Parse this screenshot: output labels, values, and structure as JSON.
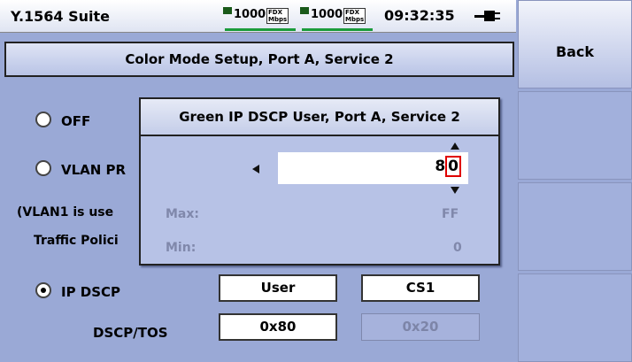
{
  "header": {
    "title": "Y.1564 Suite",
    "link1": {
      "speed": "1000",
      "duplex": "FDX",
      "unit": "Mbps",
      "color": "#1a9b3a"
    },
    "link2": {
      "speed": "1000",
      "duplex": "FDX",
      "unit": "Mbps",
      "color": "#1a9b3a"
    },
    "time": "09:32:35",
    "power_icon": "ac-plug-icon"
  },
  "page": {
    "title": "Color Mode Setup, Port A, Service 2"
  },
  "options": {
    "off": {
      "label": "OFF",
      "selected": false
    },
    "vlan": {
      "label": "VLAN PR",
      "selected": false
    },
    "vlan_note": "(VLAN1 is use",
    "traffic_policing": "Traffic Polici",
    "ip_dscp": {
      "label": "IP DSCP",
      "selected": true
    }
  },
  "fields": {
    "dscp_mode": "User",
    "dscp_class": "CS1",
    "dscp_tos_label": "DSCP/TOS",
    "dscp_tos_value": "0x80",
    "dscp_tos_other": "0x20"
  },
  "dialog": {
    "title": "Green IP DSCP User, Port A, Service 2",
    "value_prefix": "8",
    "value_cursor": "0",
    "max_label": "Max:",
    "max_value": "FF",
    "min_label": "Min:",
    "min_value": "0"
  },
  "softkeys": {
    "back": "Back"
  },
  "colors": {
    "background": "#9aa9d6",
    "link_active": "#1a9b3a",
    "cursor": "#e00000"
  }
}
